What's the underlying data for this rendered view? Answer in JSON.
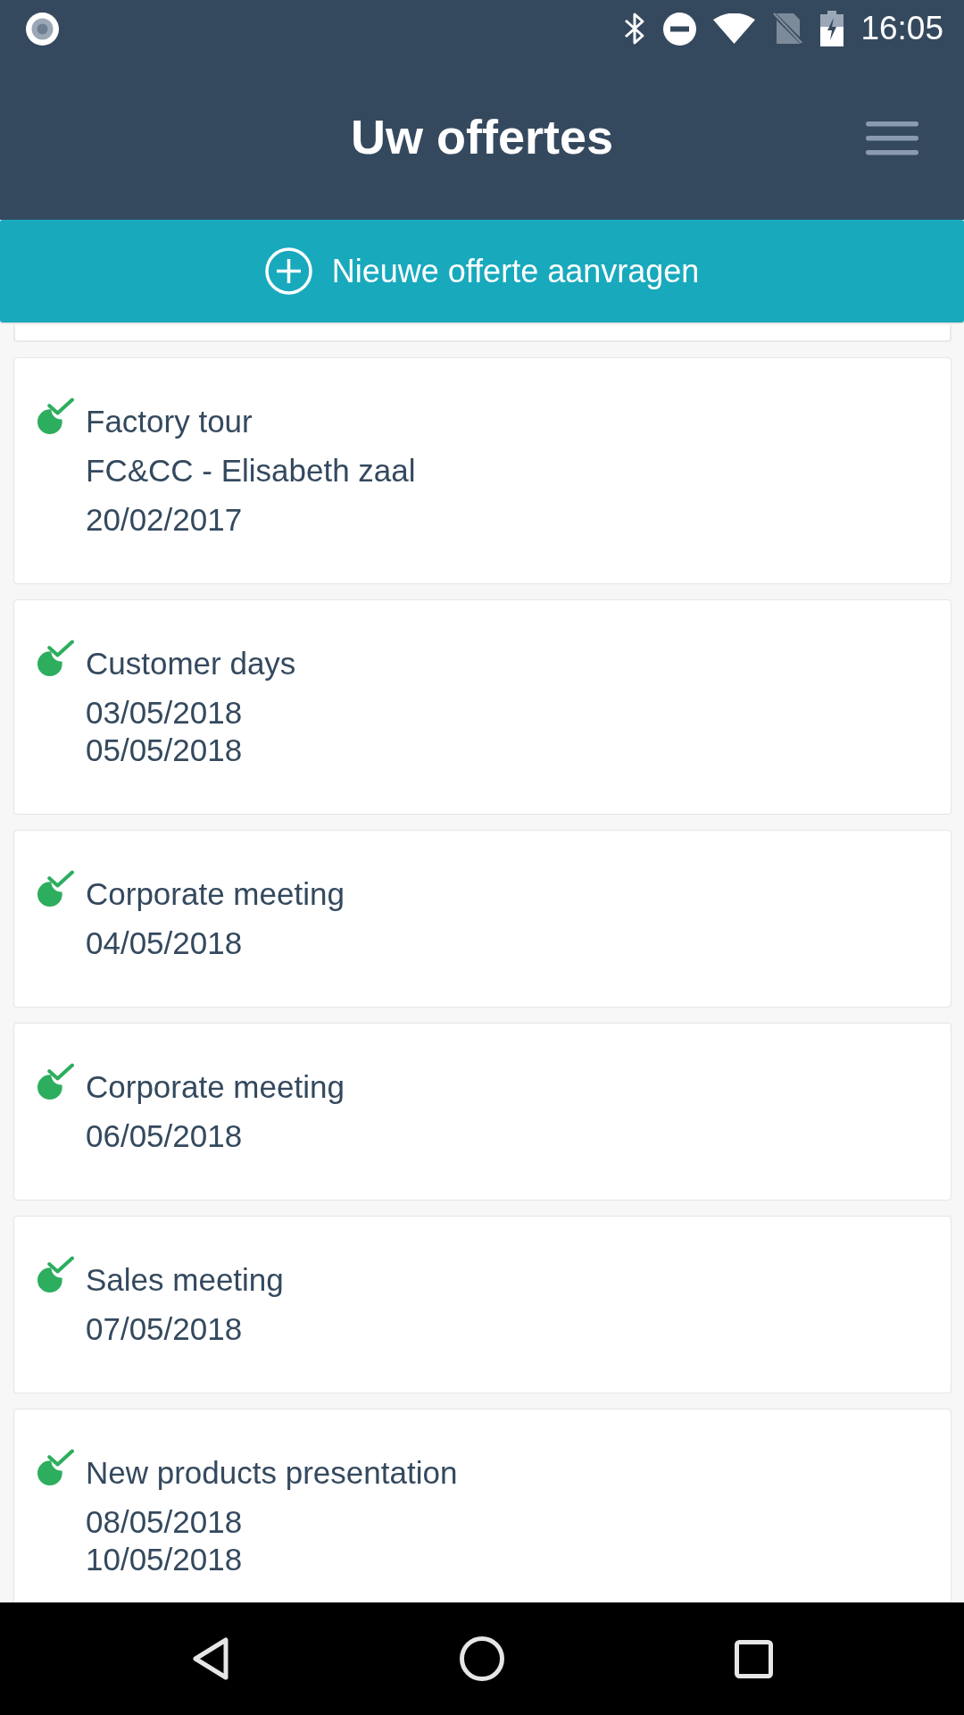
{
  "status_bar": {
    "time": "16:05"
  },
  "header": {
    "title": "Uw offertes"
  },
  "new_quote_button": {
    "label": "Nieuwe offerte aanvragen"
  },
  "quotes": [
    {
      "title": "Factory tour",
      "location": "FC&CC - Elisabeth zaal",
      "dates": [
        "20/02/2017"
      ]
    },
    {
      "title": "Customer days",
      "dates": [
        "03/05/2018",
        "05/05/2018"
      ]
    },
    {
      "title": "Corporate meeting",
      "dates": [
        "04/05/2018"
      ]
    },
    {
      "title": "Corporate meeting",
      "dates": [
        "06/05/2018"
      ]
    },
    {
      "title": "Sales meeting",
      "dates": [
        "07/05/2018"
      ]
    },
    {
      "title": "New products presentation",
      "dates": [
        "08/05/2018",
        "10/05/2018"
      ]
    }
  ]
}
